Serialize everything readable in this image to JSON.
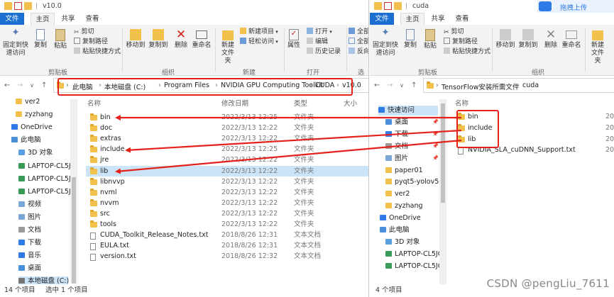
{
  "left": {
    "title": "v10.0",
    "tabs": {
      "file": "文件",
      "home": "主页",
      "share": "共享",
      "view": "查看"
    },
    "ribbon": {
      "pin": "固定到快速访问",
      "copy": "复制",
      "paste": "粘贴",
      "cut": "剪切",
      "copy_path": "复制路径",
      "paste_shortcut": "粘贴快捷方式",
      "move_to": "移动到",
      "copy_to": "复制到",
      "delete": "删除",
      "rename": "重命名",
      "new_folder": "新建文件夹",
      "new_item": "新建项目",
      "easy_access": "轻松访问",
      "properties": "属性",
      "open": "打开",
      "edit": "编辑",
      "history": "历史记录",
      "select_all": "全部",
      "select_none": "全部",
      "invert": "反向",
      "g_clipboard": "剪贴板",
      "g_organize": "组织",
      "g_new": "新建",
      "g_open": "打开",
      "g_select": "选择"
    },
    "path": [
      "此电脑",
      "本地磁盘 (C:)",
      "Program Files",
      "NVIDIA GPU Computing Toolkit",
      "CUDA",
      "v10.0"
    ],
    "columns": {
      "name": "名称",
      "date": "修改日期",
      "type": "类型",
      "size": "大小"
    },
    "nav": [
      "ver2",
      "zyzhang",
      "OneDrive",
      "此电脑",
      "3D 对象",
      "LAPTOP-CL5JCI",
      "LAPTOP-CL5JCI",
      "LAPTOP-CL5JCI",
      "视频",
      "图片",
      "文档",
      "下载",
      "音乐",
      "桌面",
      "本地磁盘 (C:)"
    ],
    "files": [
      {
        "name": "bin",
        "date": "2022/3/13 12:25",
        "type": "文件夹",
        "kind": "folder"
      },
      {
        "name": "doc",
        "date": "2022/3/13 12:22",
        "type": "文件夹",
        "kind": "folder"
      },
      {
        "name": "extras",
        "date": "2022/3/13 12:22",
        "type": "文件夹",
        "kind": "folder"
      },
      {
        "name": "include",
        "date": "2022/3/13 12:25",
        "type": "文件夹",
        "kind": "folder"
      },
      {
        "name": "jre",
        "date": "2022/3/13 12:22",
        "type": "文件夹",
        "kind": "folder"
      },
      {
        "name": "lib",
        "date": "2022/3/13 12:22",
        "type": "文件夹",
        "kind": "folder"
      },
      {
        "name": "libnvvp",
        "date": "2022/3/13 12:22",
        "type": "文件夹",
        "kind": "folder"
      },
      {
        "name": "nvml",
        "date": "2022/3/13 12:22",
        "type": "文件夹",
        "kind": "folder"
      },
      {
        "name": "nvvm",
        "date": "2022/3/13 12:22",
        "type": "文件夹",
        "kind": "folder"
      },
      {
        "name": "src",
        "date": "2022/3/13 12:22",
        "type": "文件夹",
        "kind": "folder"
      },
      {
        "name": "tools",
        "date": "2022/3/13 12:22",
        "type": "文件夹",
        "kind": "folder"
      },
      {
        "name": "CUDA_Toolkit_Release_Notes.txt",
        "date": "2018/8/26 12:31",
        "type": "文本文档",
        "kind": "file"
      },
      {
        "name": "EULA.txt",
        "date": "2018/8/26 12:31",
        "type": "文本文档",
        "kind": "file"
      },
      {
        "name": "version.txt",
        "date": "2018/8/26 12:32",
        "type": "文本文档",
        "kind": "file"
      }
    ],
    "status_count": "14 个项目",
    "status_sel": "选中 1 个项目"
  },
  "right": {
    "title": "cuda",
    "upload_label": "拖拽上传",
    "tabs": {
      "file": "文件",
      "home": "主页",
      "share": "共享",
      "view": "查看"
    },
    "ribbon": {
      "pin": "固定到快速访问",
      "copy": "复制",
      "paste": "粘贴",
      "cut": "剪切",
      "copy_path": "复制路径",
      "paste_shortcut": "粘贴快捷方式",
      "move_to": "移动到",
      "copy_to": "复制到",
      "delete": "删除",
      "rename": "重命名",
      "new_folder": "新建文件夹",
      "g_clipboard": "剪贴板",
      "g_organize": "组织"
    },
    "path": [
      "TensorFlow安装所需文件",
      "cuda"
    ],
    "columns": {
      "name": "名称"
    },
    "nav": [
      "快速访问",
      "桌面",
      "下载",
      "文档",
      "图片",
      "paper01",
      "pyqt5-yolov5-y",
      "ver2",
      "zyzhang",
      "OneDrive",
      "此电脑",
      "3D 对象",
      "LAPTOP-CL5JCI",
      "LAPTOP-CL5JCI"
    ],
    "files": [
      {
        "name": "bin",
        "date": "20",
        "kind": "folder"
      },
      {
        "name": "include",
        "date": "20",
        "kind": "folder"
      },
      {
        "name": "lib",
        "date": "20",
        "kind": "folder"
      },
      {
        "name": "NVIDIA_SLA_cuDNN_Support.txt",
        "date": "20",
        "kind": "file"
      }
    ],
    "status_count": "4 个项目"
  },
  "watermark": "CSDN @pengLiu_7611",
  "colors": {
    "accent": "#1a6fd0",
    "selection": "#cce4f7",
    "annotation_red": "#e4211b",
    "folder": "#f2c14b"
  }
}
